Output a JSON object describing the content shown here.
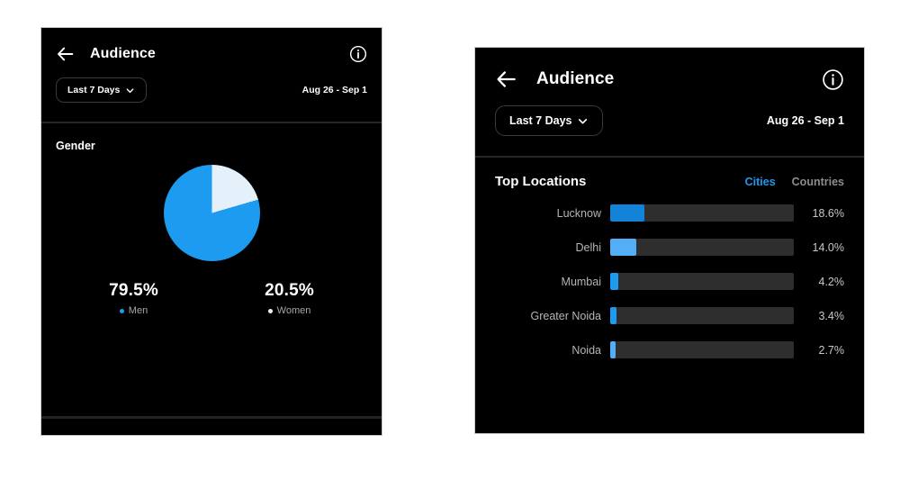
{
  "colors": {
    "accent_blue": "#1d9bf0",
    "bar_dark_blue": "#1283d6",
    "bar_light_blue": "#52aef5",
    "pie_men": "#1c9bf0",
    "pie_women": "#e4f1fb",
    "bar_track": "#2e2e2e",
    "panel_bg": "#000000",
    "page_bg": "#ffffff"
  },
  "left_panel": {
    "header": {
      "back_icon": "back-arrow-icon",
      "title": "Audience",
      "info_icon": "info-circle-icon"
    },
    "filter": {
      "range_label": "Last 7 Days",
      "chevron_icon": "chevron-down-icon",
      "date_range": "Aug 26 - Sep 1"
    },
    "gender_card": {
      "title": "Gender"
    }
  },
  "right_panel": {
    "header": {
      "back_icon": "back-arrow-icon",
      "title": "Audience",
      "info_icon": "info-circle-icon"
    },
    "filter": {
      "range_label": "Last 7 Days",
      "chevron_icon": "chevron-down-icon",
      "date_range": "Aug 26 - Sep 1"
    },
    "locations_card": {
      "title": "Top Locations",
      "tabs": [
        {
          "label": "Cities",
          "active": true
        },
        {
          "label": "Countries",
          "active": false
        }
      ]
    }
  },
  "chart_data": [
    {
      "type": "pie",
      "title": "Gender",
      "categories": [
        "Men",
        "Women"
      ],
      "values": [
        79.5,
        20.5
      ],
      "labels": [
        "79.5%",
        "20.5%"
      ],
      "colors": [
        "#1c9bf0",
        "#e4f1fb"
      ],
      "legend_position": "bottom",
      "units": "percent"
    },
    {
      "type": "bar",
      "title": "Top Locations",
      "orientation": "horizontal",
      "categories": [
        "Lucknow",
        "Delhi",
        "Mumbai",
        "Greater Noida",
        "Noida"
      ],
      "values": [
        18.6,
        14.0,
        4.2,
        3.4,
        2.7
      ],
      "labels": [
        "18.6%",
        "14.0%",
        "4.2%",
        "3.4%",
        "2.7%"
      ],
      "bar_colors": [
        "#1283d6",
        "#52aef5",
        "#1d9bf0",
        "#1d9bf0",
        "#52aef5"
      ],
      "xlim": [
        0,
        100
      ],
      "grid": false,
      "units": "percent"
    }
  ]
}
